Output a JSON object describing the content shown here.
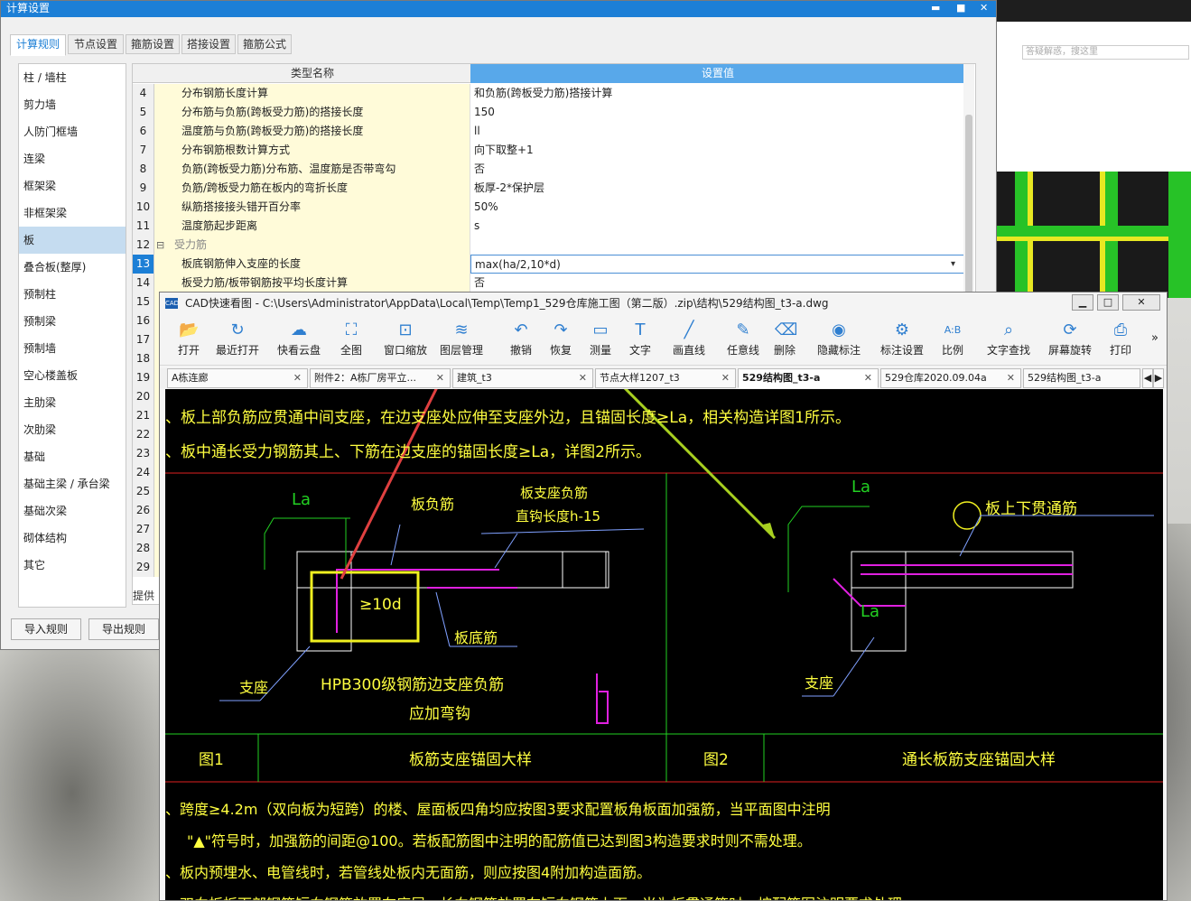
{
  "settings_window": {
    "title": "计算设置",
    "controls": {
      "min": "▬",
      "max": "■",
      "close": "✕"
    },
    "tabs": [
      {
        "label": "计算规则",
        "active": true
      },
      {
        "label": "节点设置",
        "active": false
      },
      {
        "label": "箍筋设置",
        "active": false
      },
      {
        "label": "搭接设置",
        "active": false
      },
      {
        "label": "箍筋公式",
        "active": false
      }
    ],
    "left_items": [
      "柱 / 墙柱",
      "剪力墙",
      "人防门框墙",
      "连梁",
      "框架梁",
      "非框架梁",
      "板",
      "叠合板(整厚)",
      "预制柱",
      "预制梁",
      "预制墙",
      "空心楼盖板",
      "主肋梁",
      "次肋梁",
      "基础",
      "基础主梁 / 承台梁",
      "基础次梁",
      "砌体结构",
      "其它"
    ],
    "selected_left": "板",
    "grid_header": {
      "col1": "类型名称",
      "col2": "设置值"
    },
    "rows": [
      {
        "num": "4",
        "name": "分布钢筋长度计算",
        "value": "和负筋(跨板受力筋)搭接计算"
      },
      {
        "num": "5",
        "name": "分布筋与负筋(跨板受力筋)的搭接长度",
        "value": "150"
      },
      {
        "num": "6",
        "name": "温度筋与负筋(跨板受力筋)的搭接长度",
        "value": "ll"
      },
      {
        "num": "7",
        "name": "分布钢筋根数计算方式",
        "value": "向下取整+1"
      },
      {
        "num": "8",
        "name": "负筋(跨板受力筋)分布筋、温度筋是否带弯勾",
        "value": "否"
      },
      {
        "num": "9",
        "name": "负筋/跨板受力筋在板内的弯折长度",
        "value": "板厚-2*保护层"
      },
      {
        "num": "10",
        "name": "纵筋搭接接头错开百分率",
        "value": "50%"
      },
      {
        "num": "11",
        "name": "温度筋起步距离",
        "value": "s"
      },
      {
        "num": "12",
        "name": "受力筋",
        "value": "",
        "group": true
      },
      {
        "num": "13",
        "name": "板底钢筋伸入支座的长度",
        "value": "max(ha/2,10*d)",
        "selected": true
      },
      {
        "num": "14",
        "name": "板受力筋/板带钢筋按平均长度计算",
        "value": "否"
      },
      {
        "num": "15",
        "name": "",
        "value": ""
      },
      {
        "num": "16",
        "name": "",
        "value": ""
      },
      {
        "num": "17",
        "name": "",
        "value": ""
      },
      {
        "num": "18",
        "name": "",
        "value": ""
      },
      {
        "num": "19",
        "name": "",
        "value": ""
      },
      {
        "num": "20",
        "name": "",
        "value": ""
      },
      {
        "num": "21",
        "name": "",
        "value": ""
      },
      {
        "num": "22",
        "name": "",
        "value": ""
      },
      {
        "num": "23",
        "name": "",
        "value": ""
      },
      {
        "num": "24",
        "name": "",
        "value": ""
      },
      {
        "num": "25",
        "name": "",
        "value": ""
      },
      {
        "num": "26",
        "name": "",
        "value": ""
      },
      {
        "num": "27",
        "name": "",
        "value": ""
      },
      {
        "num": "28",
        "name": "",
        "value": ""
      },
      {
        "num": "29",
        "name": "",
        "value": ""
      }
    ],
    "hint": "提供",
    "buttons": {
      "import": "导入规则",
      "export": "导出规则"
    }
  },
  "right_window": {
    "search_placeholder": "答疑解惑，搜这里"
  },
  "cad_window": {
    "title": "CAD快速看图 - C:\\Users\\Administrator\\AppData\\Local\\Temp\\Temp1_529仓库施工图（第二版）.zip\\结构\\529结构图_t3-a.dwg",
    "logo": "CAD",
    "toolbar": [
      {
        "label": "打开",
        "icon": "folder-icon",
        "glyph": "📂"
      },
      {
        "label": "最近打开",
        "icon": "history-icon",
        "glyph": "↻"
      },
      {
        "label": "快看云盘",
        "icon": "cloud-icon",
        "glyph": "☁"
      },
      {
        "label": "全图",
        "icon": "fit-icon",
        "glyph": "⛶"
      },
      {
        "label": "窗口缩放",
        "icon": "zoom-window-icon",
        "glyph": "⊡"
      },
      {
        "label": "图层管理",
        "icon": "layers-icon",
        "glyph": "≋"
      },
      {
        "label": "撤销",
        "icon": "undo-icon",
        "glyph": "↶"
      },
      {
        "label": "恢复",
        "icon": "redo-icon",
        "glyph": "↷"
      },
      {
        "label": "测量",
        "icon": "measure-icon",
        "glyph": "▭"
      },
      {
        "label": "文字",
        "icon": "text-icon",
        "glyph": "T"
      },
      {
        "label": "画直线",
        "icon": "line-icon",
        "glyph": "╱"
      },
      {
        "label": "任意线",
        "icon": "pen-icon",
        "glyph": "✎"
      },
      {
        "label": "删除",
        "icon": "eraser-icon",
        "glyph": "⌫"
      },
      {
        "label": "隐藏标注",
        "icon": "eye-icon",
        "glyph": "◉"
      },
      {
        "label": "标注设置",
        "icon": "settings-icon",
        "glyph": "⚙"
      },
      {
        "label": "比例",
        "icon": "scale-icon",
        "glyph": "A:B"
      },
      {
        "label": "文字查找",
        "icon": "search-icon",
        "glyph": "⌕"
      },
      {
        "label": "屏幕旋转",
        "icon": "rotate-icon",
        "glyph": "⟳"
      },
      {
        "label": "打印",
        "icon": "print-icon",
        "glyph": "⎙"
      }
    ],
    "more": "»",
    "doc_tabs": [
      {
        "label": "A栋连廊",
        "active": false
      },
      {
        "label": "附件2：A栋厂房平立...",
        "active": false
      },
      {
        "label": "建筑_t3",
        "active": false
      },
      {
        "label": "节点大样1207_t3",
        "active": false
      },
      {
        "label": "529结构图_t3-a",
        "active": true
      },
      {
        "label": "529仓库2020.09.04a",
        "active": false
      },
      {
        "label": "529结构图_t3-a",
        "active": false
      }
    ],
    "drawing": {
      "line1": "、板上部负筋应贯通中间支座，在边支座处应伸至支座外边，且锚固长度≥La，相关构造详图1所示。",
      "line2": "、板中通长受力钢筋其上、下筋在边支座的锚固长度≥La，详图2所示。",
      "la": "La",
      "ban_fujin": "板负筋",
      "zhizuo_fujin": "板支座负筋",
      "zhigou": "直钩长度h-15",
      "ge10d": "≥10d",
      "ban_dijin": "板底筋",
      "zhizuo": "支座",
      "hpb_1": "HPB300级钢筋边支座负筋",
      "hpb_2": "应加弯钩",
      "ban_shangxia": "板上下贯通筋",
      "fig1": "图1",
      "fig1_title": "板筋支座锚固大样",
      "fig2": "图2",
      "fig2_title": "通长板筋支座锚固大样",
      "line3": "、跨度≥4.2m（双向板为短跨）的楼、屋面板四角均应按图3要求配置板角板面加强筋，当平面图中注明",
      "line4": "\"▲\"符号时，加强筋的间距@100。若板配筋图中注明的配筋值已达到图3构造要求时则不需处理。",
      "line5": "、板内预埋水、电管线时，若管线处板内无面筋，则应按图4附加构造面筋。",
      "line6": "、双向板板下部钢筋短向钢筋放置在底层，长向钢筋放置在短向钢筋上面，当为板贯通筋时，按配筋图注明要求处理。"
    }
  }
}
